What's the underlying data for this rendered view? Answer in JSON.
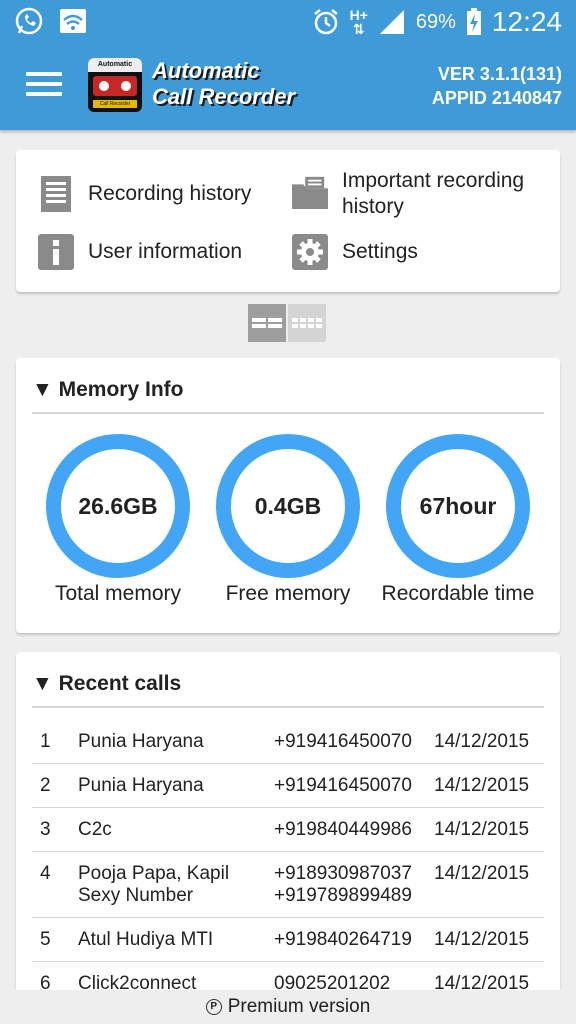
{
  "status_bar": {
    "battery_percent": "69%",
    "time": "12:24",
    "network": "H+"
  },
  "app_bar": {
    "logo_top": "Automatic",
    "logo_bottom": "Call Recorder",
    "app_name_line1": "Automatic",
    "app_name_line2": "Call Recorder",
    "version": "VER 3.1.1(131)",
    "app_id": "APPID 2140847"
  },
  "menu": {
    "recording_history": "Recording history",
    "important_recording_history": "Important recording history",
    "user_information": "User information",
    "settings": "Settings"
  },
  "memory_info": {
    "title": "Memory Info",
    "total_value": "26.6GB",
    "total_label": "Total memory",
    "free_value": "0.4GB",
    "free_label": "Free memory",
    "recordable_value": "67hour",
    "recordable_label": "Recordable time"
  },
  "recent_calls": {
    "title": "Recent calls",
    "rows": [
      {
        "num": "1",
        "name": "Punia Haryana",
        "phone": "+919416450070",
        "date": "14/12/2015"
      },
      {
        "num": "2",
        "name": "Punia Haryana",
        "phone": "+919416450070",
        "date": "14/12/2015"
      },
      {
        "num": "3",
        "name": "C2c",
        "phone": "+919840449986",
        "date": "14/12/2015"
      },
      {
        "num": "4",
        "name": "Pooja Papa, Kapil Sexy Number",
        "phone": "+918930987037 +919789899489",
        "date": "14/12/2015"
      },
      {
        "num": "5",
        "name": "Atul Hudiya MTI",
        "phone": "+919840264719",
        "date": "14/12/2015"
      },
      {
        "num": "6",
        "name": "Click2connect",
        "phone": "09025201202",
        "date": "14/12/2015"
      }
    ]
  },
  "premium": {
    "icon": "P",
    "label": "Premium version"
  },
  "colors": {
    "primary": "#3f9ad8",
    "gauge": "#42a5f5"
  }
}
